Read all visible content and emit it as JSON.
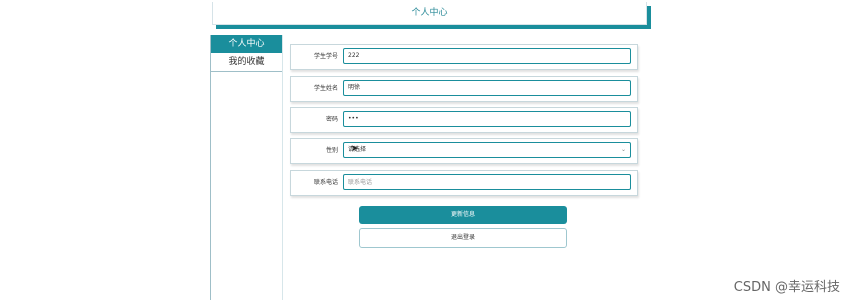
{
  "header": {
    "title": "个人中心"
  },
  "sidebar": {
    "items": [
      {
        "label": "个人中心",
        "active": true
      },
      {
        "label": "我的收藏",
        "active": false
      }
    ]
  },
  "form": {
    "student_id": {
      "label": "学生学号",
      "value": "222"
    },
    "student_name": {
      "label": "学生姓名",
      "value": "明徐"
    },
    "password": {
      "label": "密码",
      "value": "•••"
    },
    "gender": {
      "label": "性别",
      "value": "请选择"
    },
    "phone": {
      "label": "联系电话",
      "placeholder": "联系电话"
    }
  },
  "buttons": {
    "update": "更新信息",
    "logout": "退出登录"
  },
  "watermark": "CSDN @幸运科技",
  "colors": {
    "accent": "#1a8e9c"
  }
}
